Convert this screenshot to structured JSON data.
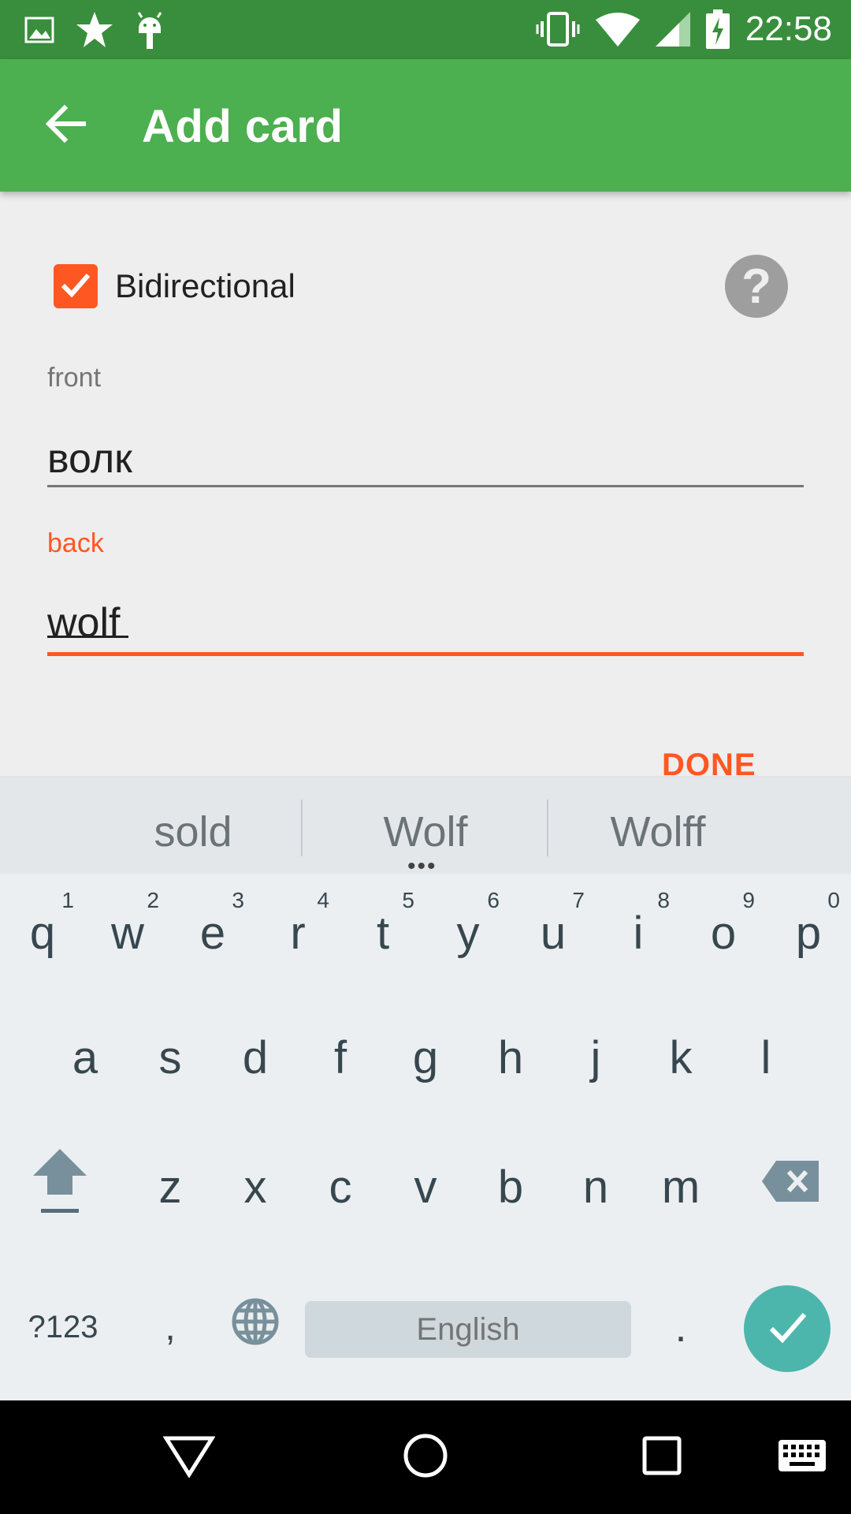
{
  "status_bar": {
    "time": "22:58",
    "left_icons": [
      "image-icon",
      "star-icon",
      "android-icon"
    ],
    "right_icons": [
      "vibrate-icon",
      "wifi-icon",
      "signal-icon",
      "battery-charging-icon"
    ]
  },
  "app_bar": {
    "title": "Add card",
    "back_icon": "arrow-back-icon",
    "color": "#4caf50"
  },
  "form": {
    "bidirectional_label": "Bidirectional",
    "bidirectional_checked": true,
    "help_icon": "question-icon",
    "front_label": "front",
    "front_value": "волк",
    "back_label": "back",
    "back_value": "wolf",
    "done_label": "DONE",
    "accent_color": "#ff5722"
  },
  "keyboard": {
    "suggestions": [
      "sold",
      "Wolf",
      "Wolff"
    ],
    "row1": [
      {
        "key": "q",
        "hint": "1"
      },
      {
        "key": "w",
        "hint": "2"
      },
      {
        "key": "e",
        "hint": "3"
      },
      {
        "key": "r",
        "hint": "4"
      },
      {
        "key": "t",
        "hint": "5"
      },
      {
        "key": "y",
        "hint": "6"
      },
      {
        "key": "u",
        "hint": "7"
      },
      {
        "key": "i",
        "hint": "8"
      },
      {
        "key": "o",
        "hint": "9"
      },
      {
        "key": "p",
        "hint": "0"
      }
    ],
    "row2": [
      "a",
      "s",
      "d",
      "f",
      "g",
      "h",
      "j",
      "k",
      "l"
    ],
    "row3": [
      "z",
      "x",
      "c",
      "v",
      "b",
      "n",
      "m"
    ],
    "symbols_label": "?123",
    "comma_label": ",",
    "space_label": "English",
    "period_label": ".",
    "enter_color": "#4db6ac"
  },
  "nav_bar": {
    "icons": [
      "back-triangle-icon",
      "home-circle-icon",
      "recents-square-icon",
      "keyboard-icon"
    ]
  }
}
